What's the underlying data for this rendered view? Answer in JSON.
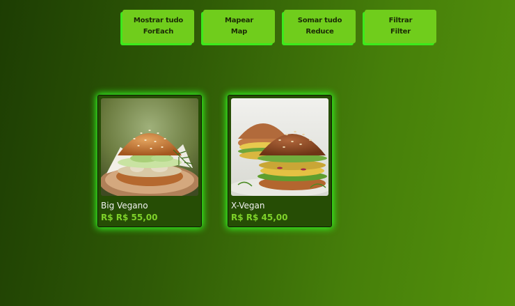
{
  "buttons": [
    {
      "line1": "Mostrar tudo",
      "line2": "ForEach"
    },
    {
      "line1": "Mapear",
      "line2": "Map"
    },
    {
      "line1": "Somar tudo",
      "line2": "Reduce"
    },
    {
      "line1": "Filtrar",
      "line2": "Filter"
    }
  ],
  "products": [
    {
      "name": "Big Vegano",
      "price": "R$ R$ 55,00"
    },
    {
      "name": "X-Vegan",
      "price": "R$ R$ 45,00"
    }
  ]
}
